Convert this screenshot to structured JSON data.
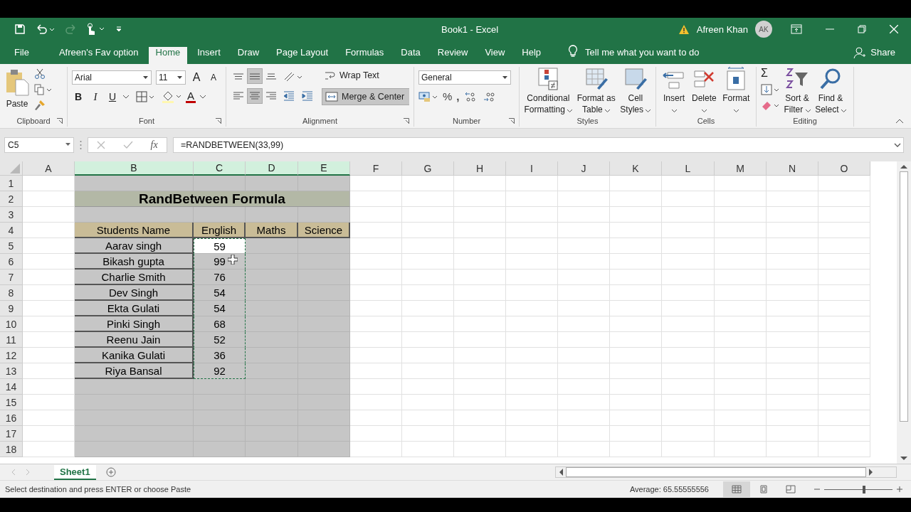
{
  "window": {
    "title": "Book1  -  Excel",
    "user": "Afreen Khan",
    "avatar": "AK"
  },
  "tabs": [
    {
      "label": "File",
      "selected": false
    },
    {
      "label": "Afreen's Fav option",
      "selected": false
    },
    {
      "label": "Home",
      "selected": true
    },
    {
      "label": "Insert",
      "selected": false
    },
    {
      "label": "Draw",
      "selected": false
    },
    {
      "label": "Page Layout",
      "selected": false
    },
    {
      "label": "Formulas",
      "selected": false
    },
    {
      "label": "Data",
      "selected": false
    },
    {
      "label": "Review",
      "selected": false
    },
    {
      "label": "View",
      "selected": false
    },
    {
      "label": "Help",
      "selected": false
    }
  ],
  "tell_me": "Tell me what you want to do",
  "share": "Share",
  "ribbon": {
    "clipboard": {
      "label": "Clipboard",
      "paste": "Paste"
    },
    "font": {
      "label": "Font",
      "name": "Arial",
      "size": "11",
      "grow": "A",
      "shrink": "A",
      "bold": "B",
      "italic": "I",
      "underline": "U",
      "font_color_letter": "A"
    },
    "alignment": {
      "label": "Alignment",
      "wrap_text": "Wrap Text",
      "merge_center": "Merge & Center",
      "merge_selected": true,
      "align_buttons": [
        {
          "kind": "top",
          "selected": false
        },
        {
          "kind": "middle",
          "selected": true
        },
        {
          "kind": "bottom",
          "selected": false
        },
        {
          "kind": "left",
          "selected": false
        },
        {
          "kind": "center",
          "selected": true
        },
        {
          "kind": "right",
          "selected": false
        }
      ]
    },
    "number": {
      "label": "Number",
      "format": "General",
      "percent": "%",
      "comma": ","
    },
    "styles": {
      "label": "Styles",
      "buttons": [
        {
          "label": "Conditional Formatting",
          "kind": "conditional"
        },
        {
          "label": "Format as Table",
          "kind": "table"
        },
        {
          "label": "Cell Styles",
          "kind": "styles"
        }
      ]
    },
    "cells": {
      "label": "Cells",
      "buttons": [
        {
          "label": "Insert",
          "kind": "insert"
        },
        {
          "label": "Delete",
          "kind": "delete"
        },
        {
          "label": "Format",
          "kind": "format"
        }
      ]
    },
    "editing": {
      "label": "Editing",
      "sigma": "Σ",
      "buttons": [
        {
          "label": "Sort & Filter",
          "kind": "sort"
        },
        {
          "label": "Find & Select",
          "kind": "find"
        }
      ]
    }
  },
  "name_box": "C5",
  "formula": "=RANDBETWEEN(33,99)",
  "fx": "fx",
  "columns": [
    {
      "label": "A",
      "selected": false
    },
    {
      "label": "B",
      "selected": true
    },
    {
      "label": "C",
      "selected": true
    },
    {
      "label": "D",
      "selected": true
    },
    {
      "label": "E",
      "selected": true
    },
    {
      "label": "F",
      "selected": false
    },
    {
      "label": "G",
      "selected": false
    },
    {
      "label": "H",
      "selected": false
    },
    {
      "label": "I",
      "selected": false
    },
    {
      "label": "J",
      "selected": false
    },
    {
      "label": "K",
      "selected": false
    },
    {
      "label": "L",
      "selected": false
    },
    {
      "label": "M",
      "selected": false
    },
    {
      "label": "N",
      "selected": false
    },
    {
      "label": "O",
      "selected": false
    }
  ],
  "rows": [
    {
      "number": "1",
      "kind": "blank"
    },
    {
      "number": "2",
      "kind": "title",
      "text": "RandBetween Formula"
    },
    {
      "number": "3",
      "kind": "blank"
    },
    {
      "number": "4",
      "kind": "header",
      "cells": [
        "Students Name",
        "English",
        "Maths",
        "Science"
      ]
    },
    {
      "number": "5",
      "kind": "record",
      "cells": [
        "Aarav singh",
        "59"
      ],
      "active": true,
      "copied": true
    },
    {
      "number": "6",
      "kind": "record",
      "cells": [
        "Bikash gupta",
        "99"
      ],
      "active": false,
      "copied": true
    },
    {
      "number": "7",
      "kind": "record",
      "cells": [
        "Charlie Smith",
        "76"
      ],
      "active": false,
      "copied": true
    },
    {
      "number": "8",
      "kind": "record",
      "cells": [
        "Dev Singh",
        "54"
      ],
      "active": false,
      "copied": true
    },
    {
      "number": "9",
      "kind": "record",
      "cells": [
        "Ekta Gulati",
        "54"
      ],
      "active": false,
      "copied": true
    },
    {
      "number": "10",
      "kind": "record",
      "cells": [
        "Pinki Singh",
        "68"
      ],
      "active": false,
      "copied": true
    },
    {
      "number": "11",
      "kind": "record",
      "cells": [
        "Reenu Jain",
        "52"
      ],
      "active": false,
      "copied": true
    },
    {
      "number": "12",
      "kind": "record",
      "cells": [
        "Kanika Gulati",
        "36"
      ],
      "active": false,
      "copied": true
    },
    {
      "number": "13",
      "kind": "record",
      "cells": [
        "Riya Bansal",
        "92"
      ],
      "active": false,
      "copied": true
    },
    {
      "number": "14",
      "kind": "blank"
    },
    {
      "number": "15",
      "kind": "blank"
    },
    {
      "number": "16",
      "kind": "blank"
    },
    {
      "number": "17",
      "kind": "blank"
    },
    {
      "number": "18",
      "kind": "blank"
    }
  ],
  "sheets": [
    {
      "label": "Sheet1",
      "selected": true
    }
  ],
  "status": {
    "message": "Select destination and press ENTER or choose Paste",
    "average": "Average: 65.55555556",
    "views": [
      {
        "kind": "normal",
        "selected": true
      },
      {
        "kind": "layout",
        "selected": false
      },
      {
        "kind": "break",
        "selected": false
      }
    ],
    "zoom": {
      "level": 0.58
    }
  }
}
